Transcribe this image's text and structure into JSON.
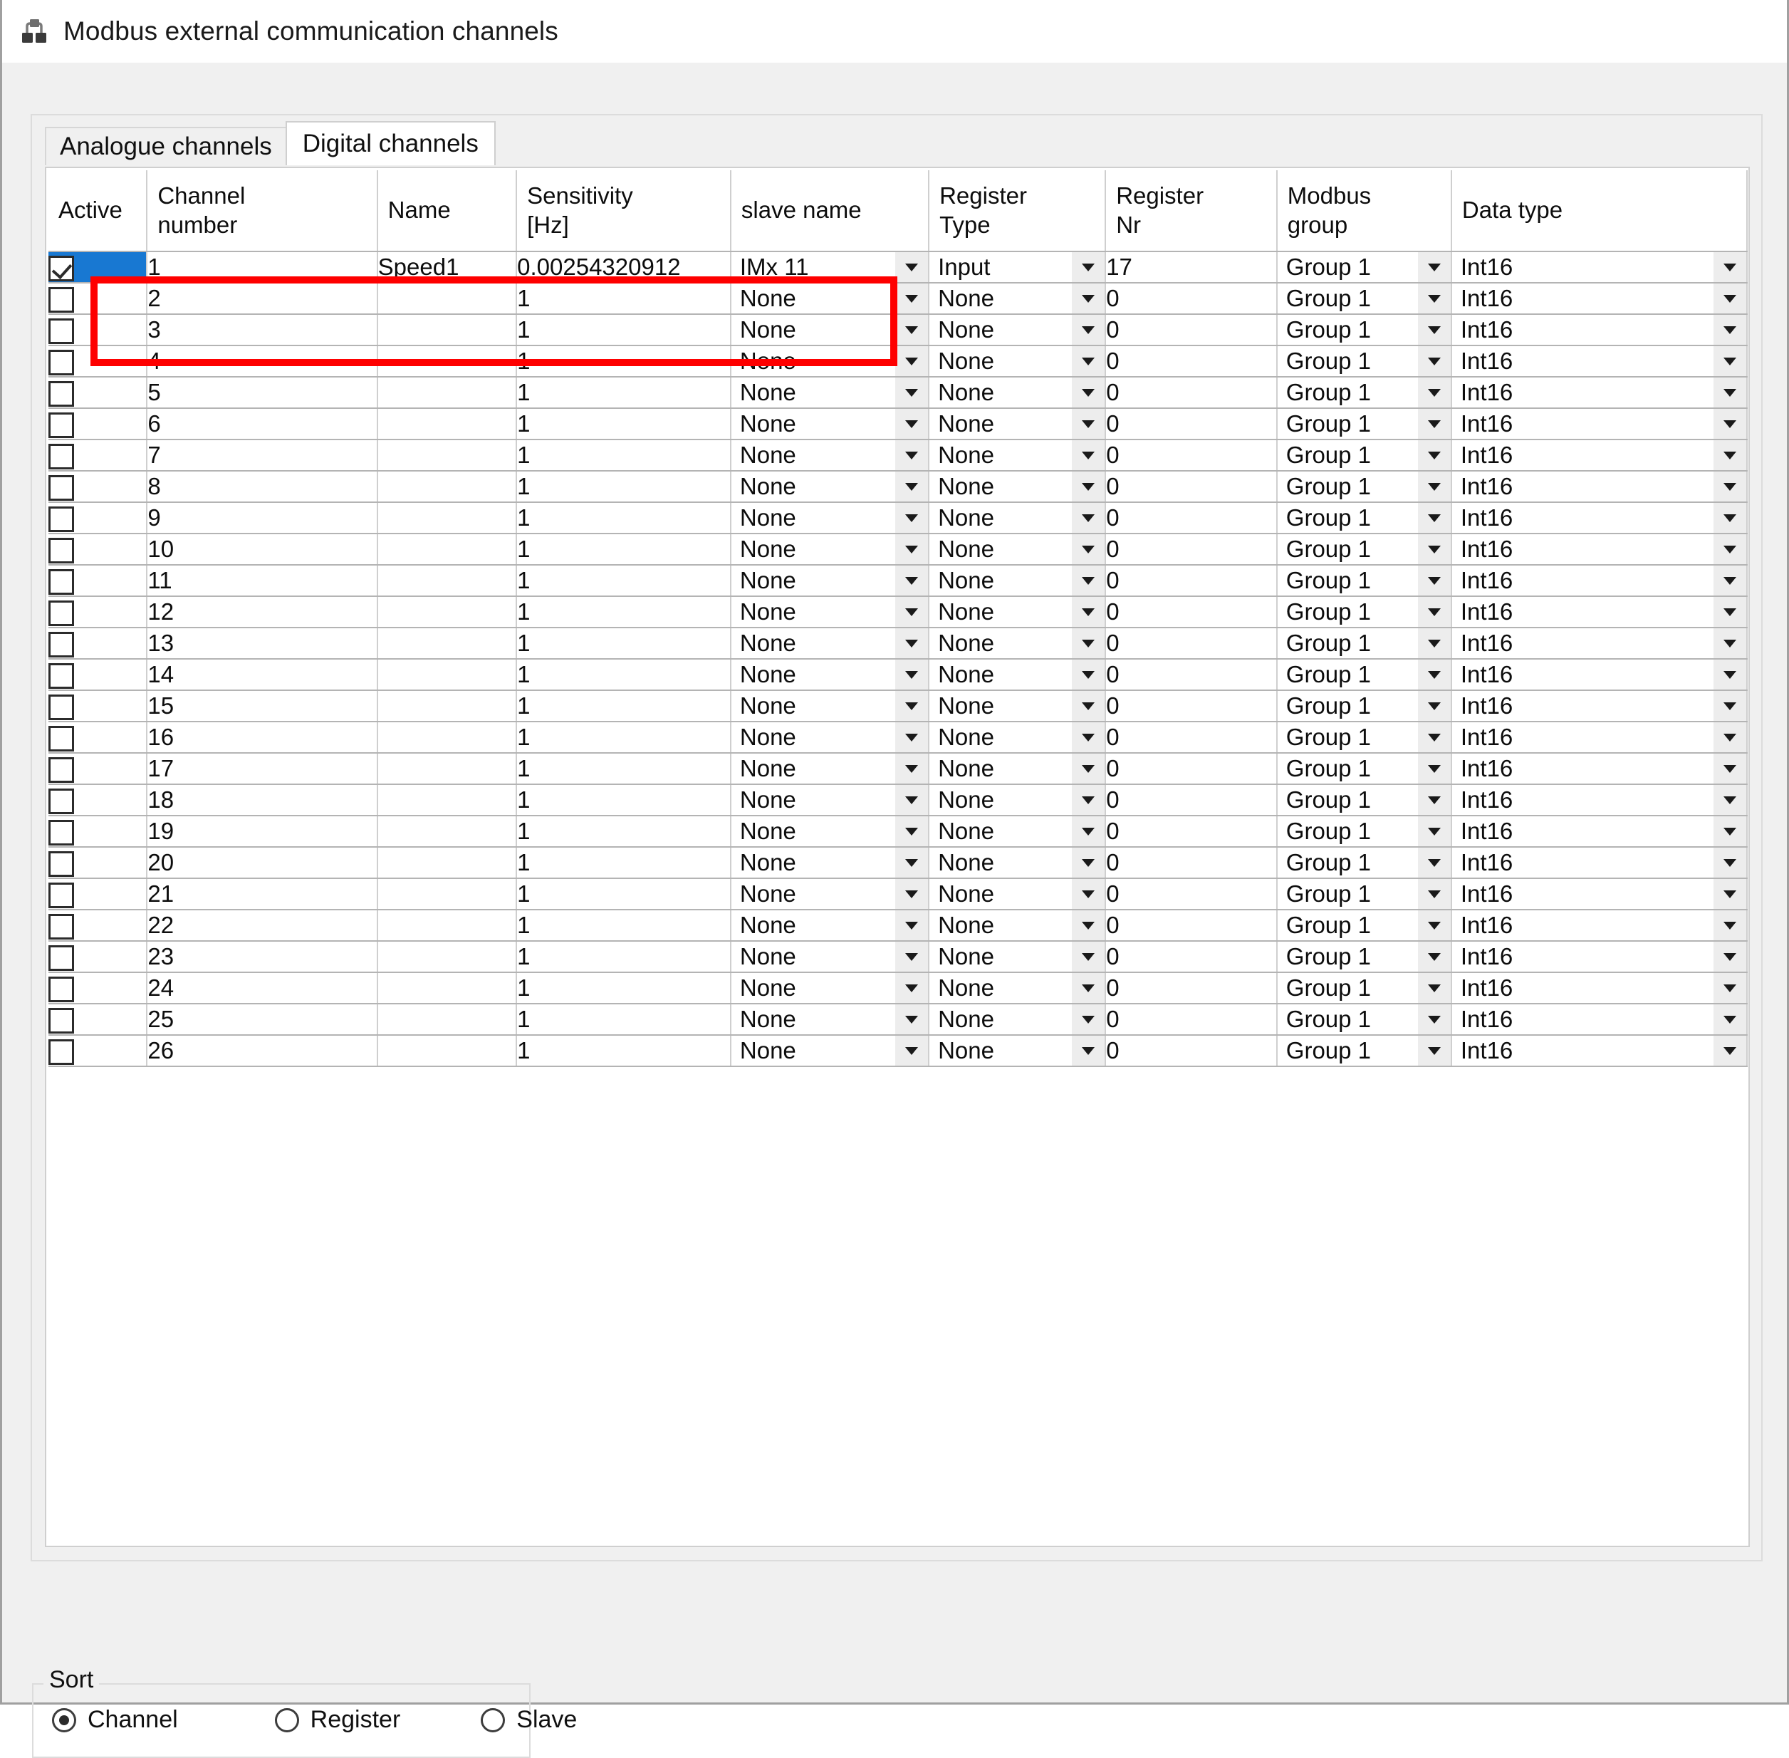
{
  "window": {
    "title": "Modbus external communication channels",
    "icon": "network-nodes-icon"
  },
  "tabs": [
    {
      "label": "Analogue channels",
      "active": false
    },
    {
      "label": "Digital channels",
      "active": true
    }
  ],
  "grid": {
    "columns": [
      "Active",
      "Channel\nnumber",
      "Name",
      "Sensitivity\n[Hz]",
      "slave name",
      "Register\nType",
      "Register\nNr",
      "Modbus\ngroup",
      "Data type"
    ],
    "column_labels": {
      "active": "Active",
      "channel_number_l1": "Channel",
      "channel_number_l2": "number",
      "name": "Name",
      "sensitivity_l1": "Sensitivity",
      "sensitivity_l2": "[Hz]",
      "slave_name": "slave name",
      "register_type_l1": "Register",
      "register_type_l2": "Type",
      "register_nr_l1": "Register",
      "register_nr_l2": "Nr",
      "modbus_group_l1": "Modbus",
      "modbus_group_l2": "group",
      "data_type": "Data type"
    },
    "selected_row_index": 0,
    "rows": [
      {
        "active": true,
        "channel": "1",
        "name": "Speed1",
        "sensitivity": "0.00254320912",
        "slave_name": "IMx 11",
        "register_type": "Input",
        "register_nr": "17",
        "modbus_group": "Group 1",
        "data_type": "Int16"
      },
      {
        "active": false,
        "channel": "2",
        "name": "",
        "sensitivity": "1",
        "slave_name": "None",
        "register_type": "None",
        "register_nr": "0",
        "modbus_group": "Group 1",
        "data_type": "Int16"
      },
      {
        "active": false,
        "channel": "3",
        "name": "",
        "sensitivity": "1",
        "slave_name": "None",
        "register_type": "None",
        "register_nr": "0",
        "modbus_group": "Group 1",
        "data_type": "Int16"
      },
      {
        "active": false,
        "channel": "4",
        "name": "",
        "sensitivity": "1",
        "slave_name": "None",
        "register_type": "None",
        "register_nr": "0",
        "modbus_group": "Group 1",
        "data_type": "Int16"
      },
      {
        "active": false,
        "channel": "5",
        "name": "",
        "sensitivity": "1",
        "slave_name": "None",
        "register_type": "None",
        "register_nr": "0",
        "modbus_group": "Group 1",
        "data_type": "Int16"
      },
      {
        "active": false,
        "channel": "6",
        "name": "",
        "sensitivity": "1",
        "slave_name": "None",
        "register_type": "None",
        "register_nr": "0",
        "modbus_group": "Group 1",
        "data_type": "Int16"
      },
      {
        "active": false,
        "channel": "7",
        "name": "",
        "sensitivity": "1",
        "slave_name": "None",
        "register_type": "None",
        "register_nr": "0",
        "modbus_group": "Group 1",
        "data_type": "Int16"
      },
      {
        "active": false,
        "channel": "8",
        "name": "",
        "sensitivity": "1",
        "slave_name": "None",
        "register_type": "None",
        "register_nr": "0",
        "modbus_group": "Group 1",
        "data_type": "Int16"
      },
      {
        "active": false,
        "channel": "9",
        "name": "",
        "sensitivity": "1",
        "slave_name": "None",
        "register_type": "None",
        "register_nr": "0",
        "modbus_group": "Group 1",
        "data_type": "Int16"
      },
      {
        "active": false,
        "channel": "10",
        "name": "",
        "sensitivity": "1",
        "slave_name": "None",
        "register_type": "None",
        "register_nr": "0",
        "modbus_group": "Group 1",
        "data_type": "Int16"
      },
      {
        "active": false,
        "channel": "11",
        "name": "",
        "sensitivity": "1",
        "slave_name": "None",
        "register_type": "None",
        "register_nr": "0",
        "modbus_group": "Group 1",
        "data_type": "Int16"
      },
      {
        "active": false,
        "channel": "12",
        "name": "",
        "sensitivity": "1",
        "slave_name": "None",
        "register_type": "None",
        "register_nr": "0",
        "modbus_group": "Group 1",
        "data_type": "Int16"
      },
      {
        "active": false,
        "channel": "13",
        "name": "",
        "sensitivity": "1",
        "slave_name": "None",
        "register_type": "None",
        "register_nr": "0",
        "modbus_group": "Group 1",
        "data_type": "Int16"
      },
      {
        "active": false,
        "channel": "14",
        "name": "",
        "sensitivity": "1",
        "slave_name": "None",
        "register_type": "None",
        "register_nr": "0",
        "modbus_group": "Group 1",
        "data_type": "Int16"
      },
      {
        "active": false,
        "channel": "15",
        "name": "",
        "sensitivity": "1",
        "slave_name": "None",
        "register_type": "None",
        "register_nr": "0",
        "modbus_group": "Group 1",
        "data_type": "Int16"
      },
      {
        "active": false,
        "channel": "16",
        "name": "",
        "sensitivity": "1",
        "slave_name": "None",
        "register_type": "None",
        "register_nr": "0",
        "modbus_group": "Group 1",
        "data_type": "Int16"
      },
      {
        "active": false,
        "channel": "17",
        "name": "",
        "sensitivity": "1",
        "slave_name": "None",
        "register_type": "None",
        "register_nr": "0",
        "modbus_group": "Group 1",
        "data_type": "Int16"
      },
      {
        "active": false,
        "channel": "18",
        "name": "",
        "sensitivity": "1",
        "slave_name": "None",
        "register_type": "None",
        "register_nr": "0",
        "modbus_group": "Group 1",
        "data_type": "Int16"
      },
      {
        "active": false,
        "channel": "19",
        "name": "",
        "sensitivity": "1",
        "slave_name": "None",
        "register_type": "None",
        "register_nr": "0",
        "modbus_group": "Group 1",
        "data_type": "Int16"
      },
      {
        "active": false,
        "channel": "20",
        "name": "",
        "sensitivity": "1",
        "slave_name": "None",
        "register_type": "None",
        "register_nr": "0",
        "modbus_group": "Group 1",
        "data_type": "Int16"
      },
      {
        "active": false,
        "channel": "21",
        "name": "",
        "sensitivity": "1",
        "slave_name": "None",
        "register_type": "None",
        "register_nr": "0",
        "modbus_group": "Group 1",
        "data_type": "Int16"
      },
      {
        "active": false,
        "channel": "22",
        "name": "",
        "sensitivity": "1",
        "slave_name": "None",
        "register_type": "None",
        "register_nr": "0",
        "modbus_group": "Group 1",
        "data_type": "Int16"
      },
      {
        "active": false,
        "channel": "23",
        "name": "",
        "sensitivity": "1",
        "slave_name": "None",
        "register_type": "None",
        "register_nr": "0",
        "modbus_group": "Group 1",
        "data_type": "Int16"
      },
      {
        "active": false,
        "channel": "24",
        "name": "",
        "sensitivity": "1",
        "slave_name": "None",
        "register_type": "None",
        "register_nr": "0",
        "modbus_group": "Group 1",
        "data_type": "Int16"
      },
      {
        "active": false,
        "channel": "25",
        "name": "",
        "sensitivity": "1",
        "slave_name": "None",
        "register_type": "None",
        "register_nr": "0",
        "modbus_group": "Group 1",
        "data_type": "Int16"
      },
      {
        "active": false,
        "channel": "26",
        "name": "",
        "sensitivity": "1",
        "slave_name": "None",
        "register_type": "None",
        "register_nr": "0",
        "modbus_group": "Group 1",
        "data_type": "Int16"
      }
    ]
  },
  "sort": {
    "legend": "Sort",
    "options": [
      {
        "label": "Channel",
        "selected": true
      },
      {
        "label": "Register",
        "selected": false
      },
      {
        "label": "Slave",
        "selected": false
      }
    ]
  },
  "annotation": {
    "highlight_color": "#fe0000",
    "selection_color": "#1878d2"
  }
}
